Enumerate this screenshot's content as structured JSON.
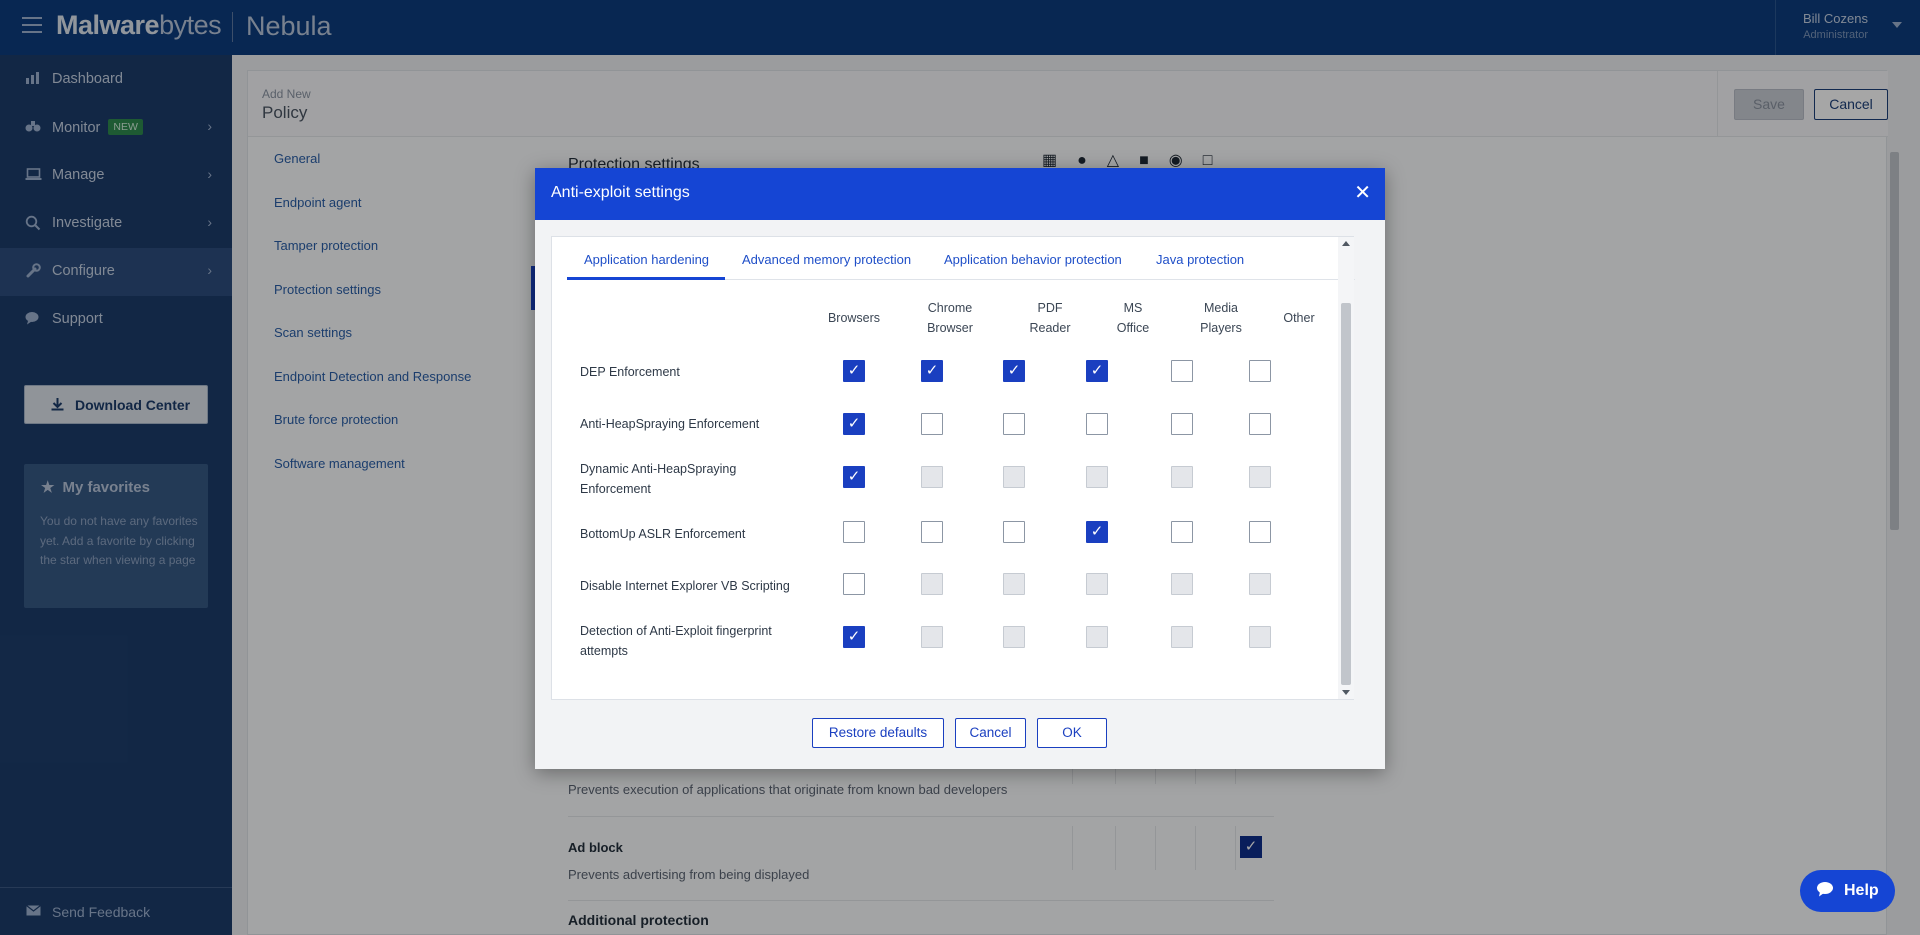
{
  "topbar": {
    "logo_bold": "Malware",
    "logo_light": "bytes",
    "product": "Nebula",
    "user_name": "Bill Cozens",
    "user_role": "Administrator"
  },
  "sidebar": {
    "items": [
      {
        "label": "Dashboard",
        "icon": "chart-icon"
      },
      {
        "label": "Monitor",
        "icon": "binoculars-icon",
        "badge": "NEW"
      },
      {
        "label": "Manage",
        "icon": "laptop-icon"
      },
      {
        "label": "Investigate",
        "icon": "search-icon"
      },
      {
        "label": "Configure",
        "icon": "wrench-icon"
      },
      {
        "label": "Support",
        "icon": "chat-icon"
      }
    ],
    "download_label": "Download Center",
    "favorites_title": "My favorites",
    "favorites_text": "You do not have any favorites yet. Add a favorite by clicking the star when viewing a page",
    "feedback_label": "Send Feedback"
  },
  "page": {
    "crumb_sub": "Add New",
    "crumb_main": "Policy",
    "save_label": "Save",
    "cancel_label": "Cancel",
    "subnav": [
      "General",
      "Endpoint agent",
      "Tamper protection",
      "Protection settings",
      "Scan settings",
      "Endpoint Detection and Response",
      "Brute force protection",
      "Software management"
    ],
    "section_title": "Protection settings",
    "row1_desc": "Prevents execution of applications that originate from known bad developers",
    "row2_title": "Ad block",
    "row2_desc": "Prevents advertising from being displayed",
    "partial_title": "Additional protection"
  },
  "modal": {
    "title": "Anti-exploit settings",
    "tabs": [
      "Application hardening",
      "Advanced memory protection",
      "Application behavior protection",
      "Java protection"
    ],
    "columns": [
      [
        "Browsers"
      ],
      [
        "Chrome",
        "Browser"
      ],
      [
        "PDF",
        "Reader"
      ],
      [
        "MS",
        "Office"
      ],
      [
        "Media",
        "Players"
      ],
      [
        "Other"
      ]
    ],
    "rows": [
      {
        "label": [
          "DEP Enforcement"
        ],
        "values": [
          "on",
          "on",
          "on",
          "on",
          "off",
          "off"
        ]
      },
      {
        "label": [
          "Anti-HeapSpraying Enforcement"
        ],
        "values": [
          "on",
          "off",
          "off",
          "off",
          "off",
          "off"
        ]
      },
      {
        "label": [
          "Dynamic Anti-HeapSpraying",
          "Enforcement"
        ],
        "values": [
          "on",
          "dis",
          "dis",
          "dis",
          "dis",
          "dis"
        ]
      },
      {
        "label": [
          "BottomUp ASLR Enforcement"
        ],
        "values": [
          "off",
          "off",
          "off",
          "on",
          "off",
          "off"
        ]
      },
      {
        "label": [
          "Disable Internet Explorer VB Scripting"
        ],
        "values": [
          "off",
          "dis",
          "dis",
          "dis",
          "dis",
          "dis"
        ]
      },
      {
        "label": [
          "Detection of Anti-Exploit fingerprint",
          "attempts"
        ],
        "values": [
          "on",
          "dis",
          "dis",
          "dis",
          "dis",
          "dis"
        ]
      }
    ],
    "restore_label": "Restore defaults",
    "cancel_label": "Cancel",
    "ok_label": "OK"
  },
  "help_label": "Help"
}
